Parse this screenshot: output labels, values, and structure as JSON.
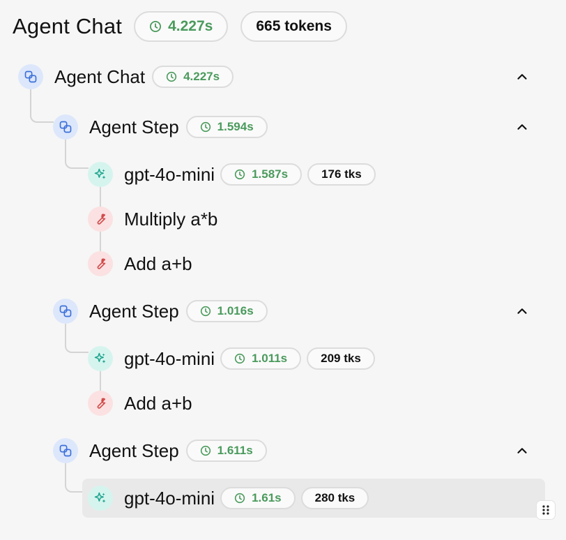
{
  "header": {
    "title": "Agent Chat",
    "duration": "4.227s",
    "tokens": "665 tokens"
  },
  "colors": {
    "agent_bg": "#dde7fb",
    "agent_fg": "#3b6fd8",
    "llm_bg": "#d6f4ee",
    "llm_fg": "#1aa38c",
    "tool_bg": "#fbe1e1",
    "tool_fg": "#d24a4a",
    "duration_green": "#4a9a5c"
  },
  "tree": {
    "root": {
      "label": "Agent Chat",
      "duration": "4.227s",
      "icon": "agent-chain-icon"
    },
    "steps": [
      {
        "label": "Agent Step",
        "duration": "1.594s",
        "icon": "agent-chain-icon",
        "children": [
          {
            "label": "gpt-4o-mini",
            "duration": "1.587s",
            "tokens": "176 tks",
            "icon": "sparkle-icon"
          },
          {
            "label": "Multiply a*b",
            "icon": "wrench-icon"
          },
          {
            "label": "Add a+b",
            "icon": "wrench-icon"
          }
        ]
      },
      {
        "label": "Agent Step",
        "duration": "1.016s",
        "icon": "agent-chain-icon",
        "children": [
          {
            "label": "gpt-4o-mini",
            "duration": "1.011s",
            "tokens": "209 tks",
            "icon": "sparkle-icon"
          },
          {
            "label": "Add a+b",
            "icon": "wrench-icon"
          }
        ]
      },
      {
        "label": "Agent Step",
        "duration": "1.611s",
        "icon": "agent-chain-icon",
        "children": [
          {
            "label": "gpt-4o-mini",
            "duration": "1.61s",
            "tokens": "280 tks",
            "icon": "sparkle-icon"
          }
        ]
      }
    ]
  }
}
